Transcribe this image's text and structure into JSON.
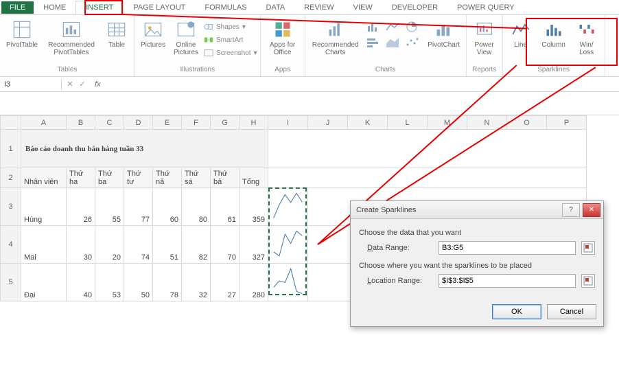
{
  "ribbon": {
    "tabs": [
      "FILE",
      "HOME",
      "INSERT",
      "PAGE LAYOUT",
      "FORMULAS",
      "DATA",
      "REVIEW",
      "VIEW",
      "DEVELOPER",
      "POWER QUERY"
    ],
    "active_tab": "INSERT",
    "groups": {
      "tables": {
        "label": "Tables",
        "pivot": "PivotTable",
        "recpivot": "Recommended PivotTables",
        "table": "Table"
      },
      "illustrations": {
        "label": "Illustrations",
        "pictures": "Pictures",
        "online": "Online Pictures",
        "shapes": "Shapes",
        "smartart": "SmartArt",
        "screenshot": "Screenshot"
      },
      "apps": {
        "label": "Apps",
        "apps_for_office": "Apps for Office"
      },
      "charts": {
        "label": "Charts",
        "recommended": "Recommended Charts",
        "pivotchart": "PivotChart"
      },
      "reports": {
        "label": "Reports",
        "powerview": "Power View"
      },
      "sparklines": {
        "label": "Sparklines",
        "line": "Line",
        "column": "Column",
        "winloss": "Win/\nLoss"
      }
    }
  },
  "namebox": {
    "cell": "I3",
    "fx": "fx"
  },
  "sheet": {
    "columns": [
      "A",
      "B",
      "C",
      "D",
      "E",
      "F",
      "G",
      "H",
      "I",
      "J",
      "K",
      "L",
      "M",
      "N",
      "O",
      "P"
    ],
    "title": "Báo cáo doanh thu bán hàng tuần 33",
    "headers": [
      "Nhân viên",
      "Thứ ha",
      "Thứ ba",
      "Thứ tư",
      "Thứ nă",
      "Thứ sá",
      "Thứ bả",
      "Tổng"
    ],
    "rows": [
      {
        "name": "Hùng",
        "vals": [
          26,
          55,
          77,
          60,
          80,
          61,
          359
        ]
      },
      {
        "name": "Mai",
        "vals": [
          30,
          20,
          74,
          51,
          82,
          70,
          327
        ]
      },
      {
        "name": "Đại",
        "vals": [
          40,
          53,
          50,
          78,
          32,
          27,
          280
        ]
      }
    ]
  },
  "dialog": {
    "title": "Create Sparklines",
    "section1": "Choose the data that you want",
    "data_range_label": "Data Range:",
    "data_range_value": "B3:G5",
    "section2": "Choose where you want the sparklines to be placed",
    "location_label": "Location Range:",
    "location_value": "$I$3:$I$5",
    "ok": "OK",
    "cancel": "Cancel"
  },
  "chart_data": [
    {
      "type": "line",
      "categories": [
        "Thứ ha",
        "Thứ ba",
        "Thứ tư",
        "Thứ nă",
        "Thứ sá",
        "Thứ bả"
      ],
      "values": [
        26,
        55,
        77,
        60,
        80,
        61
      ],
      "title": "Hùng",
      "xlabel": "",
      "ylabel": ""
    },
    {
      "type": "line",
      "categories": [
        "Thứ ha",
        "Thứ ba",
        "Thứ tư",
        "Thứ nă",
        "Thứ sá",
        "Thứ bả"
      ],
      "values": [
        30,
        20,
        74,
        51,
        82,
        70
      ],
      "title": "Mai",
      "xlabel": "",
      "ylabel": ""
    },
    {
      "type": "line",
      "categories": [
        "Thứ ha",
        "Thứ ba",
        "Thứ tư",
        "Thứ nă",
        "Thứ sá",
        "Thứ bả"
      ],
      "values": [
        40,
        53,
        50,
        78,
        32,
        27
      ],
      "title": "Đại",
      "xlabel": "",
      "ylabel": ""
    }
  ]
}
